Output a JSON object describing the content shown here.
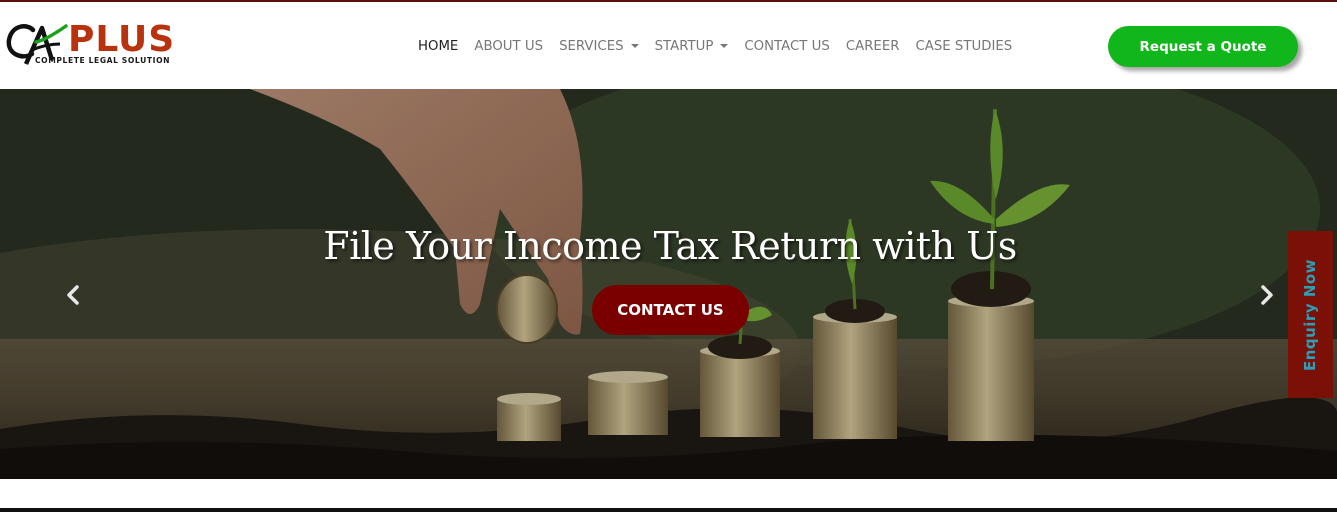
{
  "header": {
    "logo": {
      "mark": "CA",
      "brand": "PLUS",
      "tagline": "COMPLETE LEGAL SOLUTION"
    },
    "nav": [
      {
        "label": "HOME",
        "dropdown": false,
        "active": true
      },
      {
        "label": "ABOUT US",
        "dropdown": false
      },
      {
        "label": "SERVICES",
        "dropdown": true
      },
      {
        "label": "STARTUP",
        "dropdown": true
      },
      {
        "label": "CONTACT US",
        "dropdown": false
      },
      {
        "label": "CAREER",
        "dropdown": false
      },
      {
        "label": "CASE STUDIES",
        "dropdown": false
      }
    ],
    "quote_button": "Request a Quote"
  },
  "hero": {
    "title": "File Your Income Tax Return with Us",
    "cta": "CONTACT US",
    "prev_icon": "chevron-left-icon",
    "next_icon": "chevron-right-icon"
  },
  "enquiry_tab": "Enquiry Now",
  "colors": {
    "brand": "#b8320e",
    "quote_button": "#11b61a",
    "cta": "#7a0000",
    "enquiry_bg": "#7a1006",
    "enquiry_text": "#2aa0b8"
  }
}
